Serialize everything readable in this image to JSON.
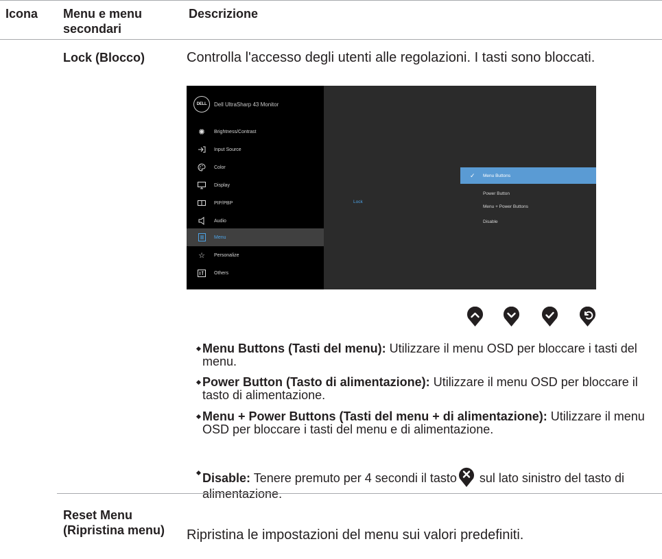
{
  "header": {
    "col_icon": "Icona",
    "col_menu": "Menu e menu secondari",
    "col_desc": "Descrizione"
  },
  "lock_row": {
    "name": "Lock (Blocco)",
    "description": "Controlla l'accesso degli utenti alle regolazioni. I tasti sono bloccati."
  },
  "osd": {
    "title": "Dell UltraSharp 43 Monitor",
    "logo": "DELL",
    "menu_items": [
      {
        "label": "Brightness/Contrast",
        "icon": "brightness-icon"
      },
      {
        "label": "Input Source",
        "icon": "input-source-icon"
      },
      {
        "label": "Color",
        "icon": "color-palette-icon"
      },
      {
        "label": "Display",
        "icon": "display-icon"
      },
      {
        "label": "PIP/PBP",
        "icon": "pip-pbp-icon"
      },
      {
        "label": "Audio",
        "icon": "speaker-icon"
      },
      {
        "label": "Menu",
        "icon": "menu-icon"
      },
      {
        "label": "Personalize",
        "icon": "star-icon"
      },
      {
        "label": "Others",
        "icon": "others-icon"
      }
    ],
    "active_item": "Menu",
    "submenu_label": "Lock",
    "options": [
      "Menu Buttons",
      "Power Button",
      "Menu + Power Buttons",
      "Disable"
    ],
    "selected_option": "Menu Buttons",
    "accent_color": "#4da3e6",
    "selected_bg": "#5a9bd4"
  },
  "control_buttons": [
    "up-arrow-icon",
    "down-arrow-icon",
    "check-icon",
    "back-icon"
  ],
  "bullets": [
    {
      "bold": "Menu Buttons (Tasti del menu):",
      "text": " Utilizzare il menu OSD per bloccare i tasti del menu."
    },
    {
      "bold": "Power Button (Tasto di alimentazione):",
      "text": " Utilizzare il menu OSD per bloccare il tasto di alimentazione."
    },
    {
      "bold": "Menu + Power Buttons (Tasti del menu + di alimentazione):",
      "text": " Utilizzare il menu OSD per bloccare i tasti del menu e di alimentazione."
    },
    {
      "bold": "Disable:",
      "text_before": " Tenere premuto per 4 secondi il tasto",
      "icon": "close-icon",
      "text_after": " sul lato sinistro del tasto di alimentazione."
    }
  ],
  "reset_row": {
    "name": "Reset Menu (Ripristina menu)",
    "description": "Ripristina le impostazioni del menu sui valori predefiniti."
  }
}
